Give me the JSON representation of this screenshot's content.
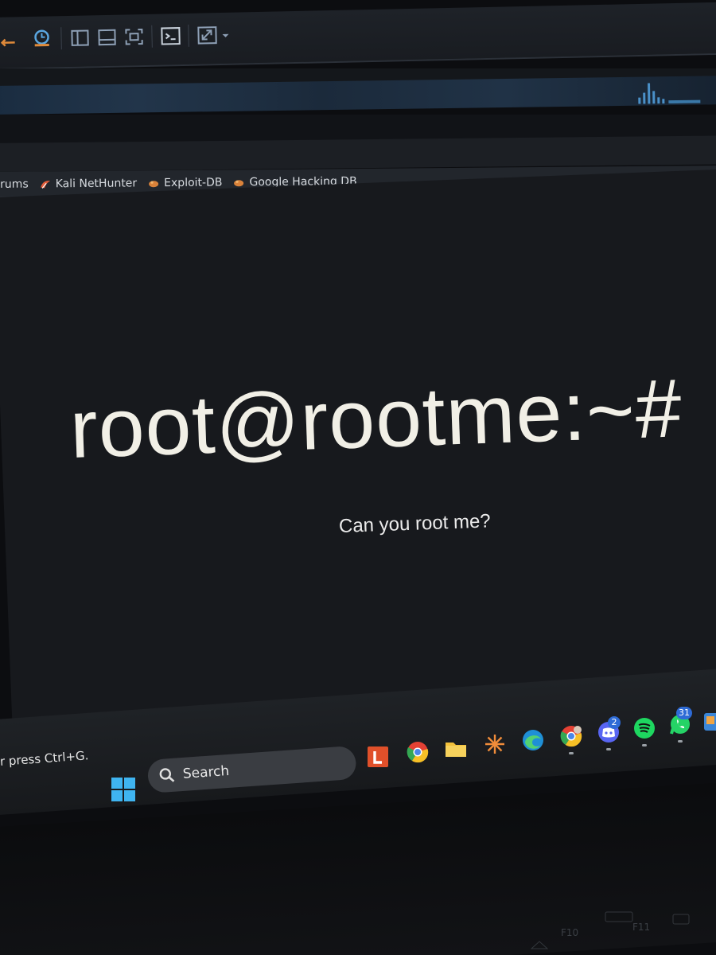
{
  "bookmarks": [
    {
      "label": "rums",
      "icon": "kali-dragon-icon"
    },
    {
      "label": "Kali NetHunter",
      "icon": "kali-dragon-icon"
    },
    {
      "label": "Exploit-DB",
      "icon": "exploit-db-icon"
    },
    {
      "label": "Google Hacking DB",
      "icon": "exploit-db-icon"
    }
  ],
  "hero": {
    "title": "root@rootme:~#",
    "subtitle": "Can you root me?"
  },
  "status_hint": "r press Ctrl+G.",
  "taskbar": {
    "search_label": "Search",
    "discord_badge": "2",
    "whatsapp_badge": "31"
  },
  "keyboard": {
    "f10": "F10",
    "f11": "F11"
  },
  "colors": {
    "page_bg": "#17191d",
    "hero_text": "#f1efe6",
    "accent_blue": "#2e6bd6"
  }
}
